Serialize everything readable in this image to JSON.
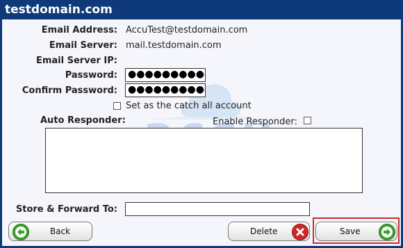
{
  "window": {
    "title": "testdomain.com"
  },
  "fields": {
    "email_address_label": "Email Address:",
    "email_address_value": "AccuTest@testdomain.com",
    "email_server_label": "Email Server:",
    "email_server_value": "mail.testdomain.com",
    "email_server_ip_label": "Email Server IP:",
    "password_label": "Password:",
    "password_value": "●●●●●●●●●●●",
    "confirm_password_label": "Confirm Password:",
    "confirm_password_value": "●●●●●●●●●●●",
    "catch_all_label": "Set as the catch all account",
    "auto_responder_label": "Auto Responder:",
    "enable_responder_label": "Enable Responder:",
    "store_forward_label": "Store & Forward To:"
  },
  "watermark": {
    "brand": "accu",
    "tagline": "web hosting"
  },
  "buttons": {
    "back": "Back",
    "delete": "Delete",
    "save": "Save"
  },
  "colors": {
    "titlebar": "#0f3a7a",
    "green_icon": "#3aa12b",
    "red_icon": "#d02626",
    "highlight": "#cc2a2a"
  }
}
